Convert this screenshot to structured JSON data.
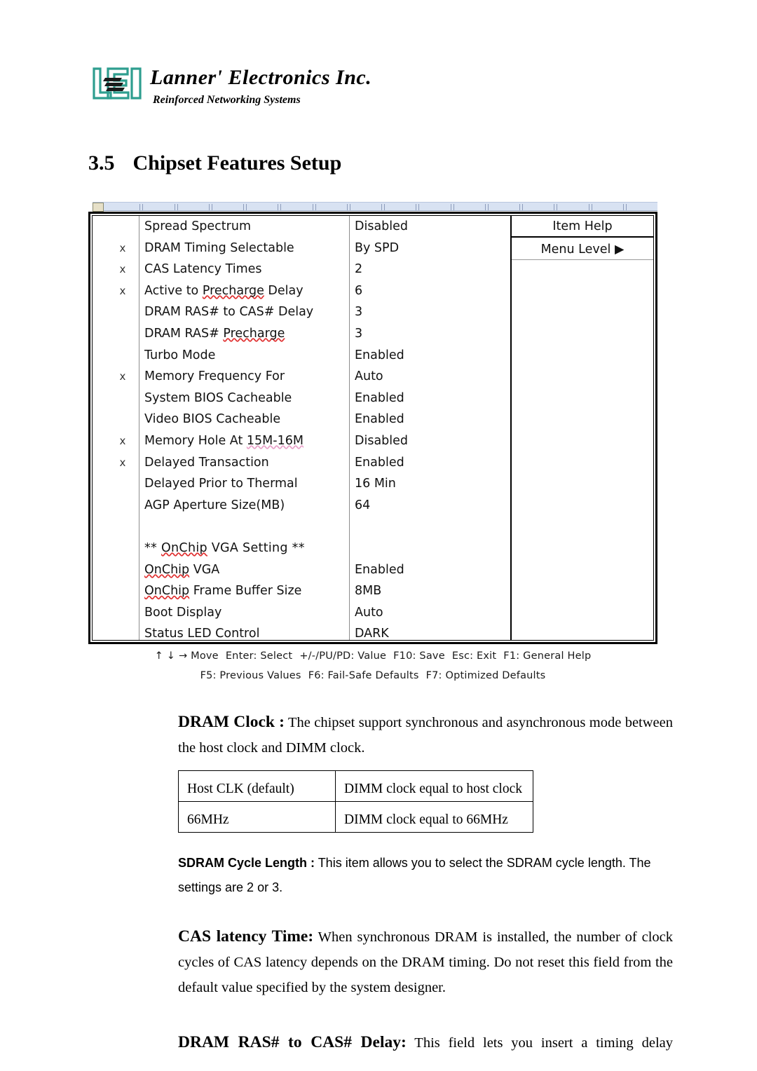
{
  "logo": {
    "mark": "lei-logo-icon",
    "company": "Lannerʹ Electronicѕ Inc.",
    "tagline": "Reinforced Networking Systems"
  },
  "heading": {
    "number": "3.5",
    "title": "Chipset Features Setup"
  },
  "bios": {
    "help_title": "Item Help",
    "menu_level": "Menu Level",
    "menu_level_arrow": "▶",
    "rows": [
      {
        "mark": "",
        "label": "Spread Spectrum",
        "value": "Disabled"
      },
      {
        "mark": "x",
        "label": "DRAM Timing Selectable",
        "value": "By SPD"
      },
      {
        "mark": "x",
        "label": "CAS Latency Times",
        "value": "2"
      },
      {
        "mark": "x",
        "label": "Active to Precharge Delay",
        "value": "6"
      },
      {
        "mark": "",
        "label": "DRAM RAS# to CAS# Delay",
        "value": "3"
      },
      {
        "mark": "",
        "label": "DRAM RAS# Precharge",
        "value": "3"
      },
      {
        "mark": "",
        "label": "Turbo Mode",
        "value": "Enabled"
      },
      {
        "mark": "x",
        "label": "Memory Frequency For",
        "value": "Auto"
      },
      {
        "mark": "",
        "label": "System BIOS Cacheable",
        "value": "Enabled"
      },
      {
        "mark": "",
        "label": "Video BIOS Cacheable",
        "value": "Enabled"
      },
      {
        "mark": "x",
        "label": "Memory Hole At 15M-16M",
        "value": "Disabled"
      },
      {
        "mark": "x",
        "label": "Delayed Transaction",
        "value": "Enabled"
      },
      {
        "mark": "",
        "label": "Delayed Prior to Thermal",
        "value": "16 Min"
      },
      {
        "mark": "",
        "label": "AGP Aperture Size(MB)",
        "value": "64"
      },
      {
        "mark": "",
        "label": "",
        "value": ""
      },
      {
        "mark": "",
        "label": "**    OnChip VGA Setting    **",
        "value": ""
      },
      {
        "mark": "",
        "label": "OnChip VGA",
        "value": "Enabled"
      },
      {
        "mark": "",
        "label": "OnChip Frame Buffer Size",
        "value": "8MB"
      },
      {
        "mark": "",
        "label": "Boot Display",
        "value": "Auto"
      },
      {
        "mark": "",
        "label": "Status LED Control",
        "value": "DARK"
      }
    ],
    "legend_line_1": [
      "↑ ↓ → Move",
      "Enter: Select",
      "+/-/PU/PD: Value",
      "F10: Save",
      "Esc: Exit",
      "F1: General Help"
    ],
    "legend_line_2": [
      "F5: Previous Values",
      "F6: Fail-Safe Defaults",
      "F7: Optimized Defaults"
    ]
  },
  "content": {
    "dram_clock": {
      "lead": "DRAM Clock :",
      "body": " The chipset support synchronous and asynchronous mode between the host clock and DIMM clock."
    },
    "dram_clock_table": {
      "rows": [
        {
          "option": "Host CLK (default)",
          "description": "DIMM clock equal to host clock"
        },
        {
          "option": "66MHz",
          "description": "DIMM clock equal to 66MHz"
        }
      ]
    },
    "sdram_cycle_length": {
      "lead": "SDRAM Cycle Length :",
      "body": " This item allows you to select the SDRAM cycle length.  The settings are 2 or 3."
    },
    "cas_latency_time": {
      "lead": "CAS latency Time:",
      "body": "  When synchronous DRAM is installed, the number of clock cycles of CAS latency depends on the DRAM timing. Do not reset this field from the default value specified by the system designer."
    },
    "dram_ras_to_cas": {
      "lead": "DRAM RAS# to CAS# Delay:",
      "body": "  This field lets you insert a timing delay"
    }
  },
  "colors": {
    "logo_teal": "#2e9e8f",
    "ruler_blue": "#d8e2f2",
    "ruler_tab": "#e6e0c8",
    "spell_red": "#e03030",
    "spell_pink": "#e8a0c8"
  }
}
